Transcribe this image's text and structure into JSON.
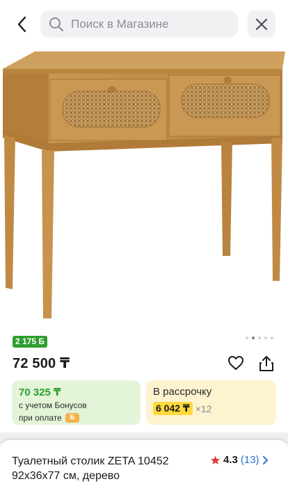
{
  "search": {
    "placeholder": "Поиск в Магазине"
  },
  "gallery": {
    "dots_count": 5,
    "active_dot": 0
  },
  "price": {
    "bonus_badge": "2 175 Б",
    "main": "72 500 ₸"
  },
  "bonus_card": {
    "amount": "70 325 ₸",
    "line1": "с учетом Бонусов",
    "line2": "при оплате",
    "coin_glyph": "Б"
  },
  "installment_card": {
    "title": "В рассрочку",
    "monthly": "6 042 ₸",
    "multiplier": "×12"
  },
  "product": {
    "title": "Туалетный столик ZETA 10452 92x36x77 см, дерево",
    "rating": "4.3",
    "reviews": "(13)"
  },
  "colors": {
    "green": "#2f9e2f",
    "link_blue": "#2a6fd6",
    "star_red": "#e0393e",
    "yellow_highlight": "#ffd93a"
  }
}
